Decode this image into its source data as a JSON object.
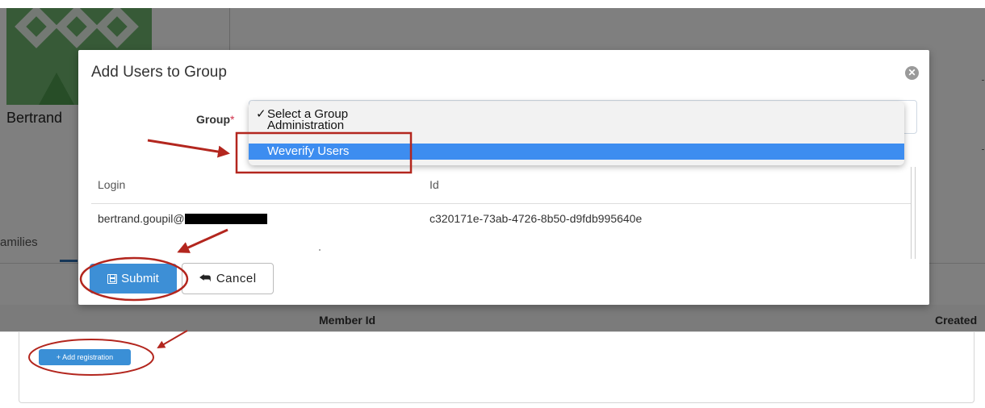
{
  "background": {
    "user_name": "Bertrand",
    "tab_label": "amilies",
    "table_columns": {
      "member_id": "Member Id",
      "created": "Created"
    },
    "add_registration_label": "+ Add registration"
  },
  "modal": {
    "title": "Add Users to Group",
    "group_field": {
      "label": "Group",
      "required_mark": "*",
      "options": [
        {
          "check": "✓",
          "label": "Select a Group",
          "selected": false
        },
        {
          "check": "",
          "label": "Administration",
          "selected": false
        },
        {
          "check": "",
          "label": "Weverify Users",
          "selected": true
        }
      ]
    },
    "table": {
      "headers": {
        "login": "Login",
        "id": "Id"
      },
      "rows": [
        {
          "login": "bertrand.goupil@",
          "id": "c320171e-73ab-4726-8b50-d9fdb995640e"
        }
      ]
    },
    "submit_label": "Submit",
    "cancel_label": "Cancel"
  },
  "colors": {
    "primary_button": "#3d8fd6",
    "dropdown_highlight": "#3d8df0",
    "annotation_red": "#b3261e",
    "overlay": "rgba(0,0,0,0.5)"
  },
  "icons": {
    "close": "close-icon",
    "submit": "floppy-disk-icon",
    "cancel": "reply-arrow-icon"
  }
}
